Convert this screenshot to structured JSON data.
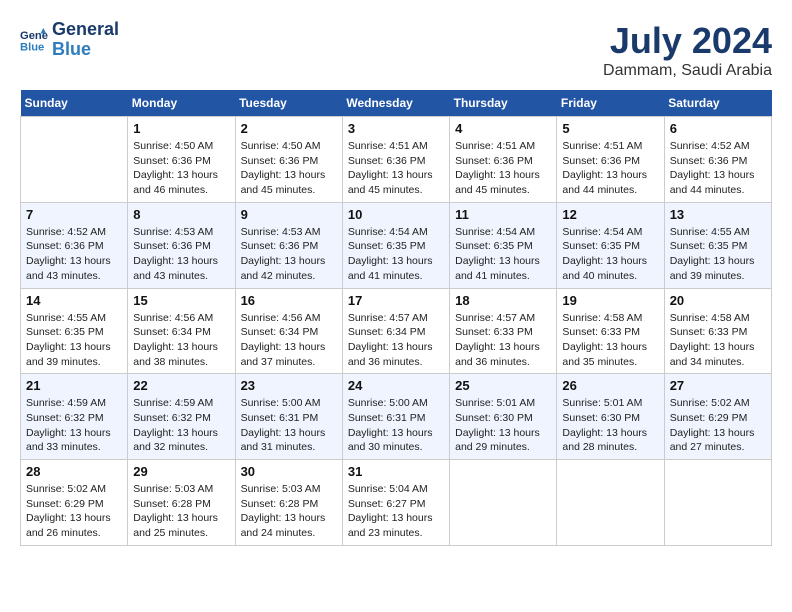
{
  "header": {
    "logo_line1": "General",
    "logo_line2": "Blue",
    "month_title": "July 2024",
    "location": "Dammam, Saudi Arabia"
  },
  "days_of_week": [
    "Sunday",
    "Monday",
    "Tuesday",
    "Wednesday",
    "Thursday",
    "Friday",
    "Saturday"
  ],
  "weeks": [
    [
      {
        "day": "",
        "sunrise": "",
        "sunset": "",
        "daylight": ""
      },
      {
        "day": "1",
        "sunrise": "Sunrise: 4:50 AM",
        "sunset": "Sunset: 6:36 PM",
        "daylight": "Daylight: 13 hours and 46 minutes."
      },
      {
        "day": "2",
        "sunrise": "Sunrise: 4:50 AM",
        "sunset": "Sunset: 6:36 PM",
        "daylight": "Daylight: 13 hours and 45 minutes."
      },
      {
        "day": "3",
        "sunrise": "Sunrise: 4:51 AM",
        "sunset": "Sunset: 6:36 PM",
        "daylight": "Daylight: 13 hours and 45 minutes."
      },
      {
        "day": "4",
        "sunrise": "Sunrise: 4:51 AM",
        "sunset": "Sunset: 6:36 PM",
        "daylight": "Daylight: 13 hours and 45 minutes."
      },
      {
        "day": "5",
        "sunrise": "Sunrise: 4:51 AM",
        "sunset": "Sunset: 6:36 PM",
        "daylight": "Daylight: 13 hours and 44 minutes."
      },
      {
        "day": "6",
        "sunrise": "Sunrise: 4:52 AM",
        "sunset": "Sunset: 6:36 PM",
        "daylight": "Daylight: 13 hours and 44 minutes."
      }
    ],
    [
      {
        "day": "7",
        "sunrise": "Sunrise: 4:52 AM",
        "sunset": "Sunset: 6:36 PM",
        "daylight": "Daylight: 13 hours and 43 minutes."
      },
      {
        "day": "8",
        "sunrise": "Sunrise: 4:53 AM",
        "sunset": "Sunset: 6:36 PM",
        "daylight": "Daylight: 13 hours and 43 minutes."
      },
      {
        "day": "9",
        "sunrise": "Sunrise: 4:53 AM",
        "sunset": "Sunset: 6:36 PM",
        "daylight": "Daylight: 13 hours and 42 minutes."
      },
      {
        "day": "10",
        "sunrise": "Sunrise: 4:54 AM",
        "sunset": "Sunset: 6:35 PM",
        "daylight": "Daylight: 13 hours and 41 minutes."
      },
      {
        "day": "11",
        "sunrise": "Sunrise: 4:54 AM",
        "sunset": "Sunset: 6:35 PM",
        "daylight": "Daylight: 13 hours and 41 minutes."
      },
      {
        "day": "12",
        "sunrise": "Sunrise: 4:54 AM",
        "sunset": "Sunset: 6:35 PM",
        "daylight": "Daylight: 13 hours and 40 minutes."
      },
      {
        "day": "13",
        "sunrise": "Sunrise: 4:55 AM",
        "sunset": "Sunset: 6:35 PM",
        "daylight": "Daylight: 13 hours and 39 minutes."
      }
    ],
    [
      {
        "day": "14",
        "sunrise": "Sunrise: 4:55 AM",
        "sunset": "Sunset: 6:35 PM",
        "daylight": "Daylight: 13 hours and 39 minutes."
      },
      {
        "day": "15",
        "sunrise": "Sunrise: 4:56 AM",
        "sunset": "Sunset: 6:34 PM",
        "daylight": "Daylight: 13 hours and 38 minutes."
      },
      {
        "day": "16",
        "sunrise": "Sunrise: 4:56 AM",
        "sunset": "Sunset: 6:34 PM",
        "daylight": "Daylight: 13 hours and 37 minutes."
      },
      {
        "day": "17",
        "sunrise": "Sunrise: 4:57 AM",
        "sunset": "Sunset: 6:34 PM",
        "daylight": "Daylight: 13 hours and 36 minutes."
      },
      {
        "day": "18",
        "sunrise": "Sunrise: 4:57 AM",
        "sunset": "Sunset: 6:33 PM",
        "daylight": "Daylight: 13 hours and 36 minutes."
      },
      {
        "day": "19",
        "sunrise": "Sunrise: 4:58 AM",
        "sunset": "Sunset: 6:33 PM",
        "daylight": "Daylight: 13 hours and 35 minutes."
      },
      {
        "day": "20",
        "sunrise": "Sunrise: 4:58 AM",
        "sunset": "Sunset: 6:33 PM",
        "daylight": "Daylight: 13 hours and 34 minutes."
      }
    ],
    [
      {
        "day": "21",
        "sunrise": "Sunrise: 4:59 AM",
        "sunset": "Sunset: 6:32 PM",
        "daylight": "Daylight: 13 hours and 33 minutes."
      },
      {
        "day": "22",
        "sunrise": "Sunrise: 4:59 AM",
        "sunset": "Sunset: 6:32 PM",
        "daylight": "Daylight: 13 hours and 32 minutes."
      },
      {
        "day": "23",
        "sunrise": "Sunrise: 5:00 AM",
        "sunset": "Sunset: 6:31 PM",
        "daylight": "Daylight: 13 hours and 31 minutes."
      },
      {
        "day": "24",
        "sunrise": "Sunrise: 5:00 AM",
        "sunset": "Sunset: 6:31 PM",
        "daylight": "Daylight: 13 hours and 30 minutes."
      },
      {
        "day": "25",
        "sunrise": "Sunrise: 5:01 AM",
        "sunset": "Sunset: 6:30 PM",
        "daylight": "Daylight: 13 hours and 29 minutes."
      },
      {
        "day": "26",
        "sunrise": "Sunrise: 5:01 AM",
        "sunset": "Sunset: 6:30 PM",
        "daylight": "Daylight: 13 hours and 28 minutes."
      },
      {
        "day": "27",
        "sunrise": "Sunrise: 5:02 AM",
        "sunset": "Sunset: 6:29 PM",
        "daylight": "Daylight: 13 hours and 27 minutes."
      }
    ],
    [
      {
        "day": "28",
        "sunrise": "Sunrise: 5:02 AM",
        "sunset": "Sunset: 6:29 PM",
        "daylight": "Daylight: 13 hours and 26 minutes."
      },
      {
        "day": "29",
        "sunrise": "Sunrise: 5:03 AM",
        "sunset": "Sunset: 6:28 PM",
        "daylight": "Daylight: 13 hours and 25 minutes."
      },
      {
        "day": "30",
        "sunrise": "Sunrise: 5:03 AM",
        "sunset": "Sunset: 6:28 PM",
        "daylight": "Daylight: 13 hours and 24 minutes."
      },
      {
        "day": "31",
        "sunrise": "Sunrise: 5:04 AM",
        "sunset": "Sunset: 6:27 PM",
        "daylight": "Daylight: 13 hours and 23 minutes."
      },
      {
        "day": "",
        "sunrise": "",
        "sunset": "",
        "daylight": ""
      },
      {
        "day": "",
        "sunrise": "",
        "sunset": "",
        "daylight": ""
      },
      {
        "day": "",
        "sunrise": "",
        "sunset": "",
        "daylight": ""
      }
    ]
  ]
}
